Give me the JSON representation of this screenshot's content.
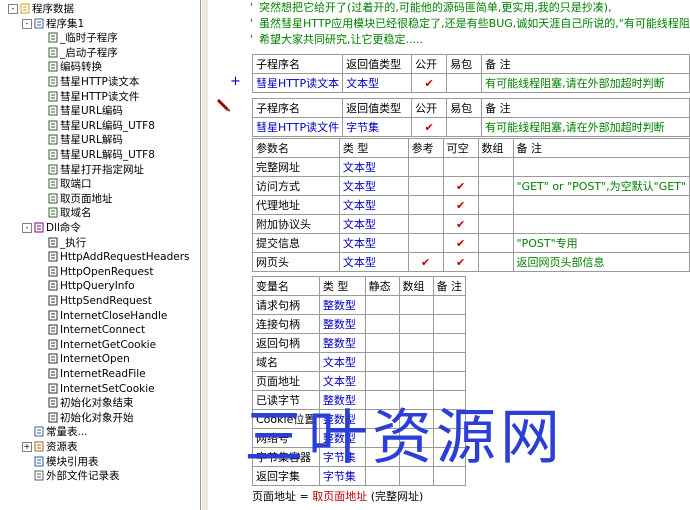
{
  "tree": {
    "items": [
      {
        "label": "程序数据",
        "level": 0,
        "icon": "folder-icon",
        "expander": "-"
      },
      {
        "label": "程序集1",
        "level": 1,
        "icon": "module-icon",
        "expander": "-"
      },
      {
        "label": "_临时子程序",
        "level": 2,
        "icon": "subroutine-icon"
      },
      {
        "label": "_启动子程序",
        "level": 2,
        "icon": "subroutine-icon"
      },
      {
        "label": "编码转换",
        "level": 2,
        "icon": "subroutine-icon"
      },
      {
        "label": "彗星HTTP读文本",
        "level": 2,
        "icon": "subroutine-icon"
      },
      {
        "label": "彗星HTTP读文件",
        "level": 2,
        "icon": "subroutine-icon"
      },
      {
        "label": "彗星URL编码",
        "level": 2,
        "icon": "subroutine-icon"
      },
      {
        "label": "彗星URL编码_UTF8",
        "level": 2,
        "icon": "subroutine-icon"
      },
      {
        "label": "彗星URL解码",
        "level": 2,
        "icon": "subroutine-icon"
      },
      {
        "label": "彗星URL解码_UTF8",
        "level": 2,
        "icon": "subroutine-icon"
      },
      {
        "label": "彗星打开指定网址",
        "level": 2,
        "icon": "subroutine-icon"
      },
      {
        "label": "取端口",
        "level": 2,
        "icon": "subroutine-icon"
      },
      {
        "label": "取页面地址",
        "level": 2,
        "icon": "subroutine-icon"
      },
      {
        "label": "取域名",
        "level": 2,
        "icon": "subroutine-icon"
      },
      {
        "label": "Dll命令",
        "level": 1,
        "icon": "dll-icon",
        "expander": "-"
      },
      {
        "label": "_执行",
        "level": 2,
        "icon": "dll-command-icon"
      },
      {
        "label": "HttpAddRequestHeaders",
        "level": 2,
        "icon": "dll-command-icon"
      },
      {
        "label": "HttpOpenRequest",
        "level": 2,
        "icon": "dll-command-icon"
      },
      {
        "label": "HttpQueryInfo",
        "level": 2,
        "icon": "dll-command-icon"
      },
      {
        "label": "HttpSendRequest",
        "level": 2,
        "icon": "dll-command-icon"
      },
      {
        "label": "InternetCloseHandle",
        "level": 2,
        "icon": "dll-command-icon"
      },
      {
        "label": "InternetConnect",
        "level": 2,
        "icon": "dll-command-icon"
      },
      {
        "label": "InternetGetCookie",
        "level": 2,
        "icon": "dll-command-icon"
      },
      {
        "label": "InternetOpen",
        "level": 2,
        "icon": "dll-command-icon"
      },
      {
        "label": "InternetReadFile",
        "level": 2,
        "icon": "dll-command-icon"
      },
      {
        "label": "InternetSetCookie",
        "level": 2,
        "icon": "dll-command-icon"
      },
      {
        "label": "初始化对象结束",
        "level": 2,
        "icon": "dll-command-icon"
      },
      {
        "label": "初始化对象开始",
        "level": 2,
        "icon": "dll-command-icon"
      },
      {
        "label": "常量表...",
        "level": 1,
        "icon": "constant-table-icon"
      },
      {
        "label": "资源表",
        "level": 1,
        "icon": "resource-table-icon",
        "expander": "+"
      },
      {
        "label": "模块引用表",
        "level": 1,
        "icon": "module-ref-icon"
      },
      {
        "label": "外部文件记录表",
        "level": 1,
        "icon": "external-file-icon"
      }
    ]
  },
  "comments": [
    "突然想把它给开了(过着开的,可能他的源码匪简单,更实用,我的只是抄凑),",
    "虽然彗星HTTP应用模块已经很稳定了,还是有些BUG,诚如天涯自己所说的,\"有可能线程阻塞",
    "希望大家共同研究,让它更稳定....."
  ],
  "sub1": {
    "headers": [
      "子程序名",
      "返回值类型",
      "公开",
      "易包",
      "备 注"
    ],
    "row": {
      "name": "彗星HTTP读文本",
      "ret": "文本型",
      "public": "✔",
      "easy": "",
      "note": "有可能线程阻塞,请在外部加超时判断"
    }
  },
  "sub2": {
    "headers": [
      "子程序名",
      "返回值类型",
      "公开",
      "易包",
      "备 注"
    ],
    "row": {
      "name": "彗星HTTP读文件",
      "ret": "字节集",
      "public": "✔",
      "easy": "",
      "note": "有可能线程阻塞,请在外部加超时判断"
    },
    "param_headers": [
      "参数名",
      "类 型",
      "参考",
      "可空",
      "数组",
      "备 注"
    ],
    "params": [
      {
        "name": "完整网址",
        "type": "文本型",
        "ref": "",
        "opt": "",
        "arr": "",
        "note": ""
      },
      {
        "name": "访问方式",
        "type": "文本型",
        "ref": "",
        "opt": "✔",
        "arr": "",
        "note": "\"GET\" or \"POST\",为空默认\"GET\""
      },
      {
        "name": "代理地址",
        "type": "文本型",
        "ref": "",
        "opt": "✔",
        "arr": "",
        "note": ""
      },
      {
        "name": "附加协议头",
        "type": "文本型",
        "ref": "",
        "opt": "✔",
        "arr": "",
        "note": ""
      },
      {
        "name": "提交信息",
        "type": "文本型",
        "ref": "",
        "opt": "✔",
        "arr": "",
        "note": "\"POST\"专用"
      },
      {
        "name": "网页头",
        "type": "文本型",
        "ref": "✔",
        "opt": "✔",
        "arr": "",
        "note": "返回网页头部信息"
      }
    ]
  },
  "locals": {
    "headers": [
      "变量名",
      "类 型",
      "静态",
      "数组",
      "备 注"
    ],
    "rows": [
      {
        "name": "请求句柄",
        "type": "整数型"
      },
      {
        "name": "连接句柄",
        "type": "整数型"
      },
      {
        "name": "返回句柄",
        "type": "整数型"
      },
      {
        "name": "域名",
        "type": "文本型"
      },
      {
        "name": "页面地址",
        "type": "文本型"
      },
      {
        "name": "已读字节",
        "type": "整数型"
      },
      {
        "name": "Cookie位置",
        "type": "整数型"
      },
      {
        "name": "网络号",
        "type": "整数型"
      },
      {
        "name": "字节集容器",
        "type": "字节集"
      },
      {
        "name": "返回字集",
        "type": "字节集"
      }
    ]
  },
  "code_line": {
    "lhs": "页面地址",
    "eq": "=",
    "func": "取页面地址",
    "arg": "(完整网址)"
  },
  "watermark": "三叶资源网",
  "colors": {
    "keyword_blue": "#0000c0",
    "comment_green": "#008000",
    "check_red": "#c00000",
    "watermark_blue": "#2b3fd6"
  }
}
